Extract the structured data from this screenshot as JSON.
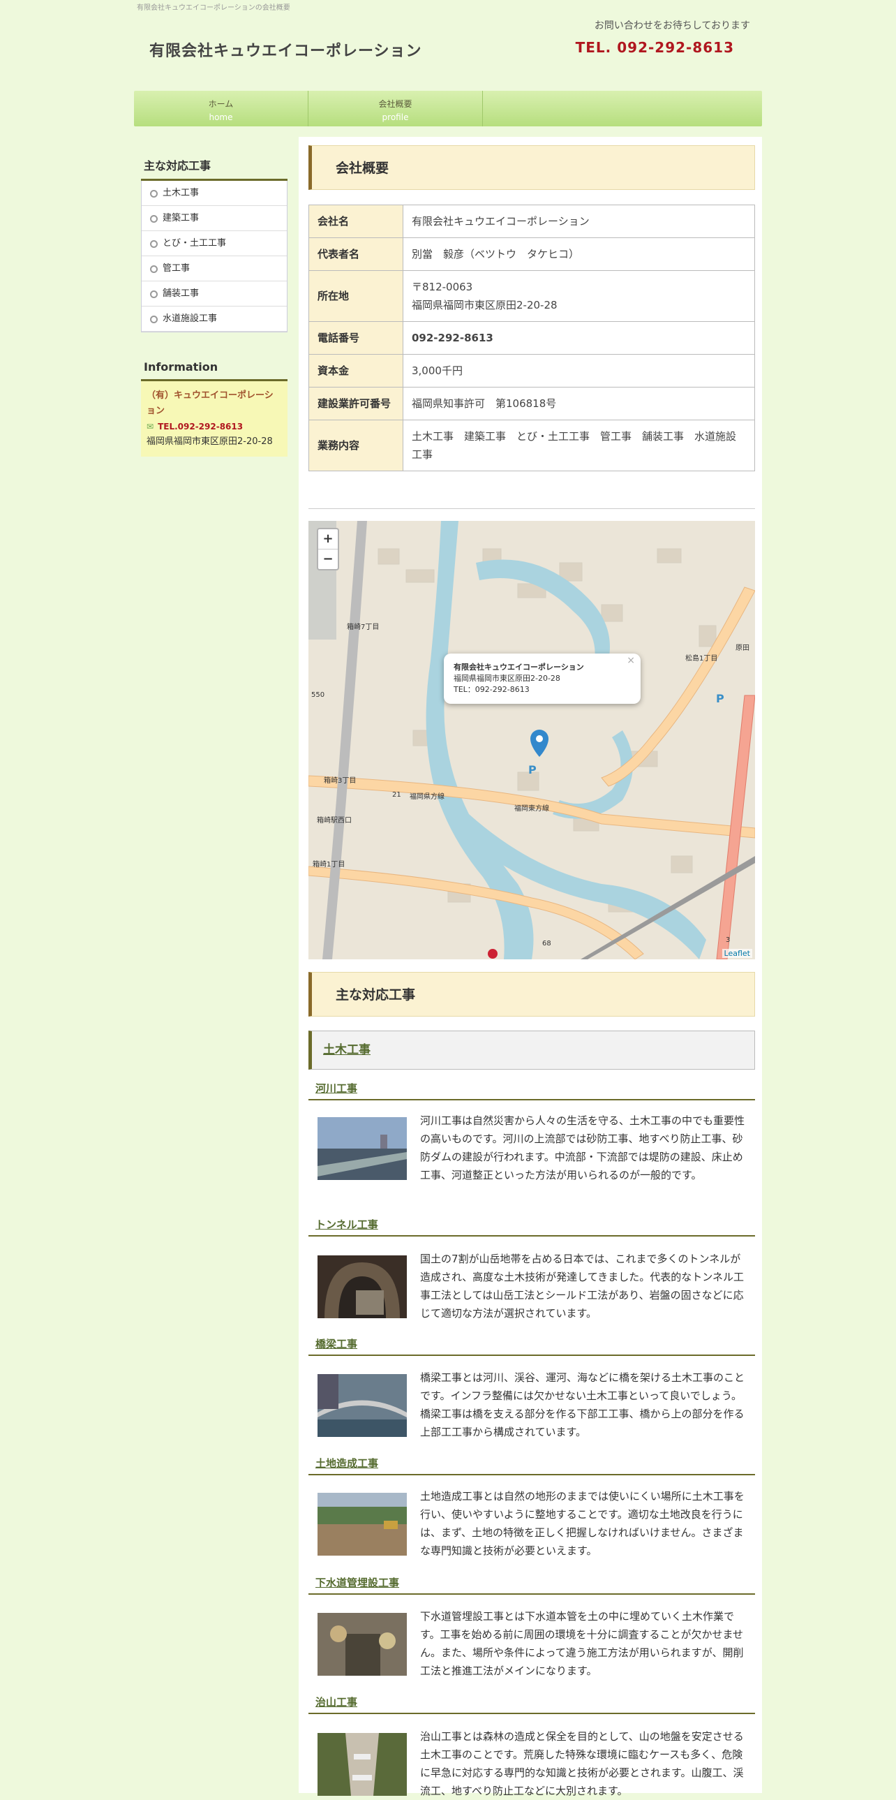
{
  "header": {
    "topline": "有限会社キュウエイコーポレーションの会社概要",
    "site_title": "有限会社キュウエイコーポレーション",
    "contact_note": "お問い合わせをお待ちしております",
    "tel": "TEL. 092-292-8613"
  },
  "nav": [
    {
      "jp": "ホーム",
      "en": "home"
    },
    {
      "jp": "会社概要",
      "en": "profile"
    }
  ],
  "sidebar": {
    "heading": "主な対応工事",
    "items": [
      "土木工事",
      "建築工事",
      "とび・土工工事",
      "管工事",
      "舗装工事",
      "水道施設工事"
    ],
    "info_heading": "Information",
    "info_name": "（有）キュウエイコーポレーション",
    "info_tel": "TEL.092-292-8613",
    "info_address": "福岡県福岡市東区原田2-20-28"
  },
  "main": {
    "profile_heading": "会社概要",
    "profile": [
      {
        "label": "会社名",
        "value": "有限会社キュウエイコーポレーション"
      },
      {
        "label": "代表者名",
        "value": "別當　毅彦（ベツトウ　タケヒコ）"
      },
      {
        "label": "所在地",
        "value": "〒812-0063\n福岡県福岡市東区原田2-20-28"
      },
      {
        "label": "電話番号",
        "value": "092-292-8613"
      },
      {
        "label": "資本金",
        "value": "3,000千円"
      },
      {
        "label": "建設業許可番号",
        "value": "福岡県知事許可　第106818号"
      },
      {
        "label": "業務内容",
        "value": "土木工事　建築工事　とび・土工工事　管工事　舗装工事　水道施設工事"
      }
    ],
    "map": {
      "zoom_in": "+",
      "zoom_out": "−",
      "popup_name": "有限会社キュウエイコーポレーション",
      "popup_address": "福岡県福岡市東区原田2-20-28",
      "popup_tel": "TEL：092-292-8613",
      "popup_close": "×",
      "attribution": "Leaflet",
      "labels": [
        "箱崎7丁目",
        "箱崎3丁目",
        "箱崎駅西口",
        "箱崎1丁目",
        "松島1丁目",
        "原田",
        "福岡県方線",
        "福岡東方線",
        "550",
        "21",
        "68",
        "3"
      ]
    },
    "works_heading": "主な対応工事",
    "category": "土木工事",
    "works": [
      {
        "title": "河川工事",
        "text": "河川工事は自然災害から人々の生活を守る、土木工事の中でも重要性の高いものです。河川の上流部では砂防工事、地すべり防止工事、砂防ダムの建設が行われます。中流部・下流部では堤防の建設、床止め工事、河道整正といった方法が用いられるのが一般的です。"
      },
      {
        "title": "トンネル工事",
        "text": "国土の7割が山岳地帯を占める日本では、これまで多くのトンネルが造成され、高度な土木技術が発達してきました。代表的なトンネル工事工法としては山岳工法とシールド工法があり、岩盤の固さなどに応じて適切な方法が選択されています。"
      },
      {
        "title": "橋梁工事",
        "text": "橋梁工事とは河川、渓谷、運河、海などに橋を架ける土木工事のことです。インフラ整備には欠かせない土木工事といって良いでしょう。橋梁工事は橋を支える部分を作る下部工工事、橋から上の部分を作る上部工工事から構成されています。"
      },
      {
        "title": "土地造成工事",
        "text": "土地造成工事とは自然の地形のままでは使いにくい場所に土木工事を行い、使いやすいように整地することです。適切な土地改良を行うには、まず、土地の特徴を正しく把握しなければいけません。さまざまな専門知識と技術が必要といえます。"
      },
      {
        "title": "下水道管埋設工事",
        "text": "下水道管埋設工事とは下水道本管を土の中に埋めていく土木作業です。工事を始める前に周囲の環境を十分に調査することが欠かせません。また、場所や条件によって違う施工方法が用いられますが、開削工法と推進工法がメインになります。"
      },
      {
        "title": "治山工事",
        "text": "治山工事とは森林の造成と保全を目的として、山の地盤を安定させる土木工事のことです。荒廃した特殊な環境に臨むケースも多く、危険に早急に対応する専門的な知識と技術が必要とされます。山腹工、渓流工、地すべり防止工などに大別されます。"
      }
    ]
  },
  "colors": {
    "accent_red": "#b0171f",
    "nav_green": "#b6de7e",
    "heading_bg": "#fbf2d2",
    "olive": "#6b6b2a",
    "page_bg": "#eef9dc"
  }
}
